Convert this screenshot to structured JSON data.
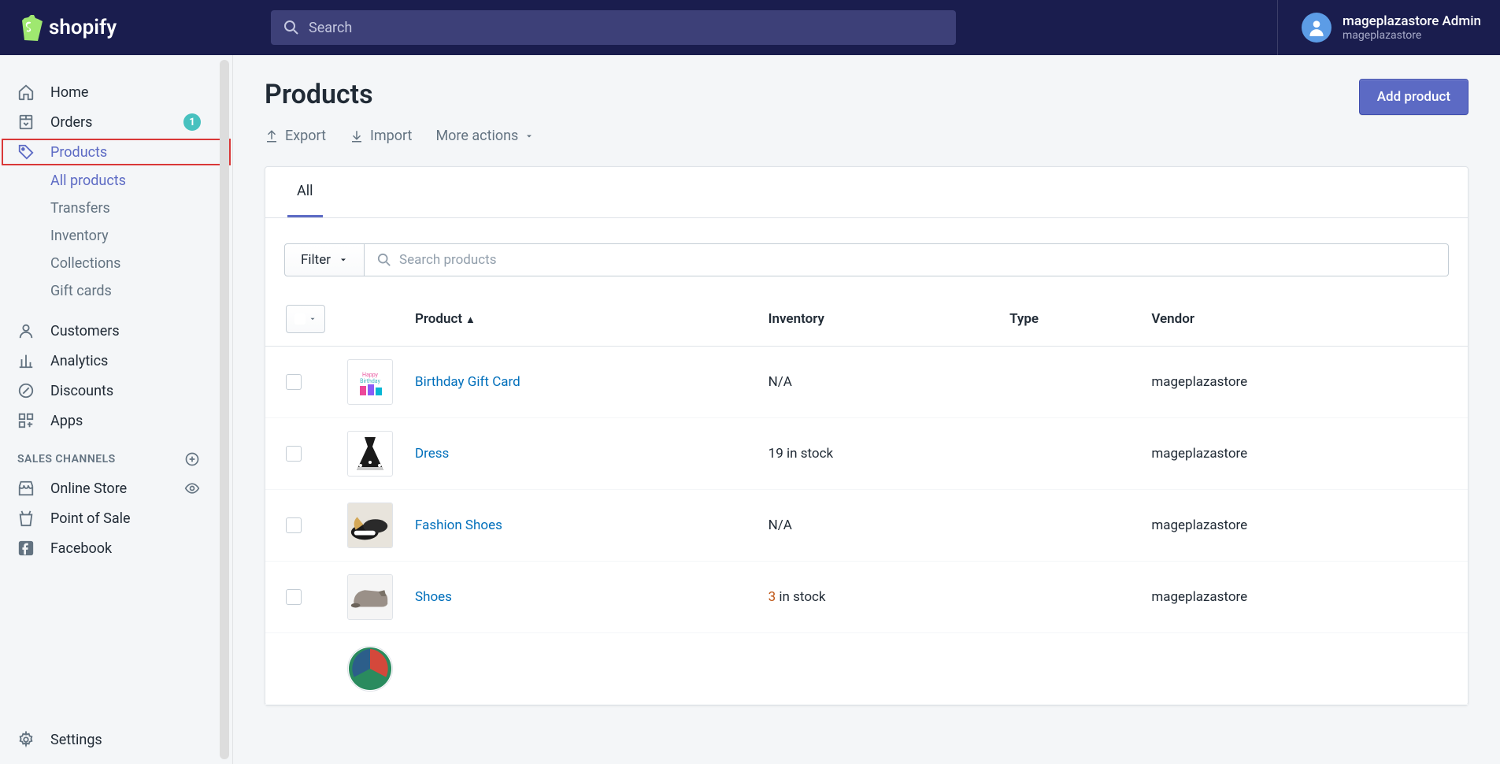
{
  "header": {
    "brand": "shopify",
    "search_placeholder": "Search",
    "user_name": "mageplazastore Admin",
    "user_sub": "mageplazastore"
  },
  "sidebar": {
    "items": [
      {
        "label": "Home"
      },
      {
        "label": "Orders",
        "badge": "1"
      },
      {
        "label": "Products"
      }
    ],
    "product_sub": [
      {
        "label": "All products"
      },
      {
        "label": "Transfers"
      },
      {
        "label": "Inventory"
      },
      {
        "label": "Collections"
      },
      {
        "label": "Gift cards"
      }
    ],
    "items2": [
      {
        "label": "Customers"
      },
      {
        "label": "Analytics"
      },
      {
        "label": "Discounts"
      },
      {
        "label": "Apps"
      }
    ],
    "section_title": "SALES CHANNELS",
    "channels": [
      {
        "label": "Online Store"
      },
      {
        "label": "Point of Sale"
      },
      {
        "label": "Facebook"
      }
    ],
    "settings": "Settings"
  },
  "page": {
    "title": "Products",
    "export": "Export",
    "import": "Import",
    "more": "More actions",
    "add_btn": "Add product",
    "tab_all": "All",
    "filter_label": "Filter",
    "search_placeholder": "Search products",
    "cols": {
      "product": "Product",
      "inventory": "Inventory",
      "type": "Type",
      "vendor": "Vendor"
    },
    "rows": [
      {
        "name": "Birthday Gift Card",
        "inv": "N/A",
        "type": "",
        "vendor": "mageplazastore"
      },
      {
        "name": "Dress",
        "inv": "19 in stock",
        "type": "",
        "vendor": "mageplazastore"
      },
      {
        "name": "Fashion Shoes",
        "inv": "N/A",
        "type": "",
        "vendor": "mageplazastore"
      },
      {
        "name": "Shoes",
        "inv_count": "3",
        "inv_suffix": " in stock",
        "type": "",
        "vendor": "mageplazastore"
      }
    ]
  }
}
